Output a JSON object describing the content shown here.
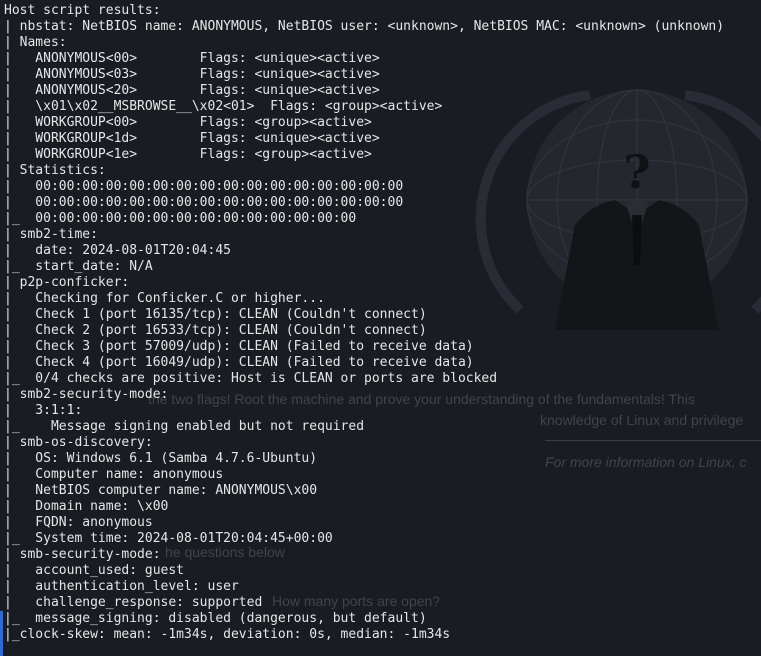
{
  "background": {
    "color": "#1a1c23",
    "texts": [
      {
        "id": "bg-line-1",
        "text": "the two flags! Root the machine and prove your understanding of the fundamentals! This",
        "italic": false
      },
      {
        "id": "bg-line-2",
        "text": "knowledge of Linux and privilege",
        "italic": false
      },
      {
        "id": "bg-line-3",
        "text": "For more information on Linux, c",
        "italic": true
      },
      {
        "id": "bg-line-4",
        "text": "he questions below",
        "italic": false
      },
      {
        "id": "bg-line-5",
        "text": "How many ports are open?",
        "italic": false
      }
    ]
  },
  "terminal": {
    "text_color": "#e6e6e6",
    "accent_bar_color": "#2f6bd0",
    "lines": [
      "Host script results:",
      "| nbstat: NetBIOS name: ANONYMOUS, NetBIOS user: <unknown>, NetBIOS MAC: <unknown> (unknown)",
      "| Names:",
      "|   ANONYMOUS<00>        Flags: <unique><active>",
      "|   ANONYMOUS<03>        Flags: <unique><active>",
      "|   ANONYMOUS<20>        Flags: <unique><active>",
      "|   \\x01\\x02__MSBROWSE__\\x02<01>  Flags: <group><active>",
      "|   WORKGROUP<00>        Flags: <group><active>",
      "|   WORKGROUP<1d>        Flags: <unique><active>",
      "|   WORKGROUP<1e>        Flags: <group><active>",
      "| Statistics:",
      "|   00:00:00:00:00:00:00:00:00:00:00:00:00:00:00:00",
      "|   00:00:00:00:00:00:00:00:00:00:00:00:00:00:00:00",
      "|_  00:00:00:00:00:00:00:00:00:00:00:00:00:00",
      "| smb2-time:",
      "|   date: 2024-08-01T20:04:45",
      "|_  start_date: N/A",
      "| p2p-conficker:",
      "|   Checking for Conficker.C or higher...",
      "|   Check 1 (port 16135/tcp): CLEAN (Couldn't connect)",
      "|   Check 2 (port 16533/tcp): CLEAN (Couldn't connect)",
      "|   Check 3 (port 57009/udp): CLEAN (Failed to receive data)",
      "|   Check 4 (port 16049/udp): CLEAN (Failed to receive data)",
      "|_  0/4 checks are positive: Host is CLEAN or ports are blocked",
      "| smb2-security-mode:",
      "|   3:1:1:",
      "|_    Message signing enabled but not required",
      "| smb-os-discovery:",
      "|   OS: Windows 6.1 (Samba 4.7.6-Ubuntu)",
      "|   Computer name: anonymous",
      "|   NetBIOS computer name: ANONYMOUS\\x00",
      "|   Domain name: \\x00",
      "|   FQDN: anonymous",
      "|_  System time: 2024-08-01T20:04:45+00:00",
      "| smb-security-mode:",
      "|   account_used: guest",
      "|   authentication_level: user",
      "|   challenge_response: supported",
      "|_  message_signing: disabled (dangerous, but default)",
      "|_clock-skew: mean: -1m34s, deviation: 0s, median: -1m34s"
    ]
  }
}
